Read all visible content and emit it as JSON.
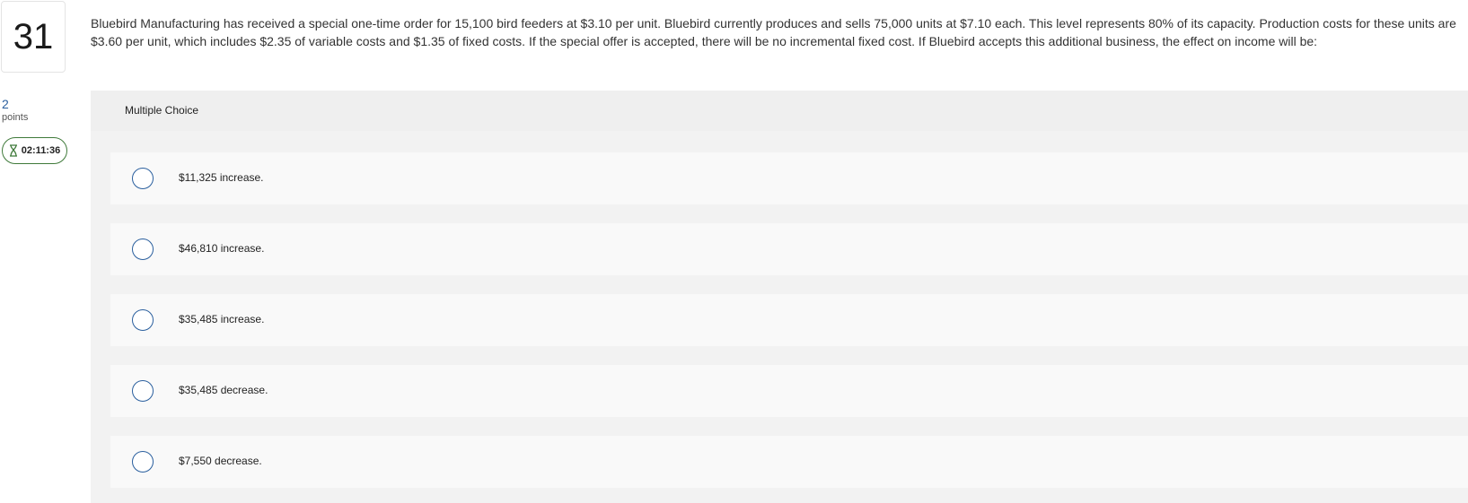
{
  "question": {
    "number": "31",
    "text_line1": "Bluebird Manufacturing has received a special one-time order for 15,100 bird feeders at $3.10 per unit. Bluebird currently produces and sells 75,000 units at $7.10 each. This level represents 80% of its capacity. Production costs for these units are",
    "text_line2": "$3.60 per unit, which includes $2.35 of variable costs and $1.35 of fixed costs. If the special offer is accepted, there will be no incremental fixed cost. If Bluebird accepts this additional business, the effect on income will be:"
  },
  "sidebar": {
    "points_value": "2",
    "points_label": "points",
    "timer": "02:11:36",
    "timer_icon": "hourglass-icon",
    "timer_color": "#3f7a3a"
  },
  "panel": {
    "title": "Multiple Choice",
    "choices": [
      {
        "label": "$11,325 increase."
      },
      {
        "label": "$46,810 increase."
      },
      {
        "label": "$35,485 increase."
      },
      {
        "label": "$35,485 decrease."
      },
      {
        "label": "$7,550 decrease."
      }
    ]
  },
  "colors": {
    "accent": "#2a5f9e",
    "panel_bg": "#f2f2f2",
    "choice_bg": "#f9f9f9"
  }
}
